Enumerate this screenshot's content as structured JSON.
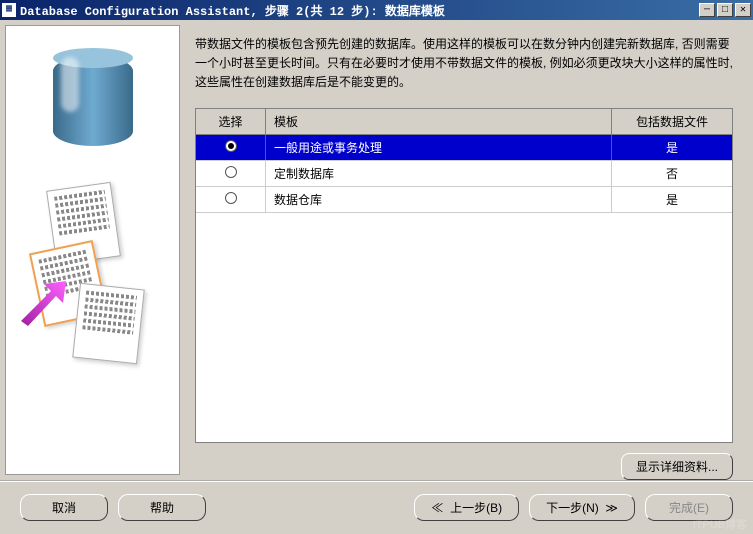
{
  "window": {
    "title": "Database Configuration Assistant, 步骤 2(共 12 步): 数据库模板"
  },
  "description": "带数据文件的模板包含预先创建的数据库。使用这样的模板可以在数分钟内创建完新数据库, 否则需要一个小时甚至更长时间。只有在必要时才使用不带数据文件的模板, 例如必须更改块大小这样的属性时, 这些属性在创建数据库后是不能变更的。",
  "table": {
    "headers": {
      "select": "选择",
      "template": "模板",
      "include": "包括数据文件"
    },
    "rows": [
      {
        "template": "一般用途或事务处理",
        "include": "是",
        "selected": true
      },
      {
        "template": "定制数据库",
        "include": "否",
        "selected": false
      },
      {
        "template": "数据仓库",
        "include": "是",
        "selected": false
      }
    ]
  },
  "buttons": {
    "details": "显示详细资料...",
    "cancel": "取消",
    "help": "帮助",
    "back": "上一步(B)",
    "next": "下一步(N)",
    "finish": "完成(E)"
  },
  "watermark": "ITPUB博客"
}
